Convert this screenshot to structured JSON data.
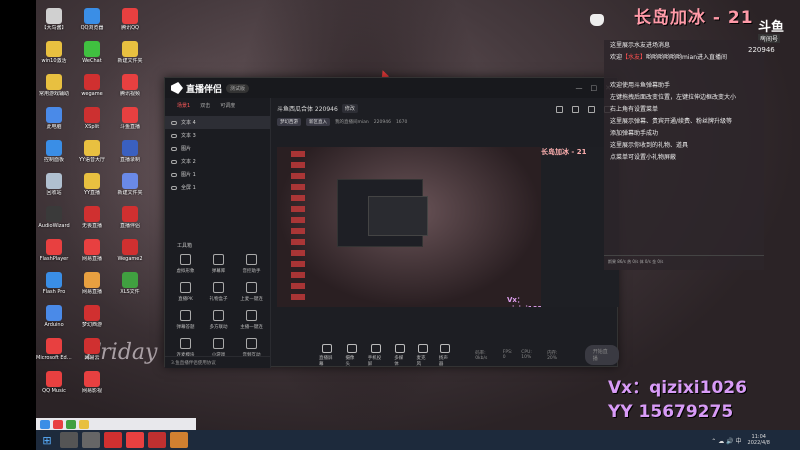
{
  "overlay": {
    "streamer_title": "长岛加冰 - 21",
    "platform": "斗鱼",
    "room_label": "房间号",
    "room_number": "220946",
    "wechat": "Vx：qizixi1026",
    "yy": "YY 15679275"
  },
  "chat": {
    "lines": [
      {
        "text": "这里展示水友进场消息"
      },
      {
        "prefix": "欢迎",
        "red": "【水友】",
        "text": "哟哟哟哟哟哟mian进入直播间"
      },
      {
        "text": ""
      },
      {
        "text": ""
      },
      {
        "text": "欢迎使用斗鱼弹幕助手"
      },
      {
        "text": "左键拖拽后面改变位置，左键拉伸边框改变大小"
      },
      {
        "text": "右上角有设置菜单"
      },
      {
        "text": "这里展示弹幕、贵宾开通/续费、粉丝牌升级等"
      },
      {
        "text": "添加弹幕助手成功"
      },
      {
        "text": "这里展示你收到的礼物、道具"
      },
      {
        "text": "点菜单可设置小礼物屏蔽"
      }
    ],
    "status": "斯果 86/s 热 0/s 体 0/s 金 0/s"
  },
  "desktop_icons": [
    {
      "label": "【大鸟酱】",
      "color": "#d0d0d0"
    },
    {
      "label": "QQ浏览器",
      "color": "#3a8ee6"
    },
    {
      "label": "腾讯QQ",
      "color": "#e84040"
    },
    {
      "label": "win10激活",
      "color": "#e8c040"
    },
    {
      "label": "WeChat",
      "color": "#40c040"
    },
    {
      "label": "新建文件夹",
      "color": "#e8c040"
    },
    {
      "label": "常用游戏辅助",
      "color": "#e8c040"
    },
    {
      "label": "wegame",
      "color": "#d03030"
    },
    {
      "label": "腾讯视频",
      "color": "#e84040"
    },
    {
      "label": "此电脑",
      "color": "#4a8ae8"
    },
    {
      "label": "XSplit",
      "color": "#cc3030"
    },
    {
      "label": "斗鱼直播",
      "color": "#e84040"
    },
    {
      "label": "控制面板",
      "color": "#3a8ee6"
    },
    {
      "label": "YY语音大厅",
      "color": "#e8c040"
    },
    {
      "label": "直播录制",
      "color": "#3a60c0"
    },
    {
      "label": "回收站",
      "color": "#b0c0d0"
    },
    {
      "label": "YY直播",
      "color": "#e8c040"
    },
    {
      "label": "新建文件夹",
      "color": "#6a8ae8"
    },
    {
      "label": "AudioWizard",
      "color": "#3a3a3a"
    },
    {
      "label": "无畏直播",
      "color": "#d03030"
    },
    {
      "label": "直播伴侣",
      "color": "#d03030"
    },
    {
      "label": "FlashPlayer",
      "color": "#e84040"
    },
    {
      "label": "网易直播",
      "color": "#e84040"
    },
    {
      "label": "Wegame2",
      "color": "#d03030"
    },
    {
      "label": "Flash Pro",
      "color": "#3a8ee6"
    },
    {
      "label": "网易直播",
      "color": "#e8a040"
    },
    {
      "label": "XLS文件",
      "color": "#40a040"
    },
    {
      "label": "Arduino",
      "color": "#4a8ae8"
    },
    {
      "label": "梦幻西游",
      "color": "#d03030"
    },
    {
      "label": "",
      "color": "transparent"
    },
    {
      "label": "Microsoft Edge",
      "color": "#e84040"
    },
    {
      "label": "网易云",
      "color": "#d03030"
    },
    {
      "label": "",
      "color": "transparent"
    },
    {
      "label": "QQ Music",
      "color": "#e84040"
    },
    {
      "label": "网易影视",
      "color": "#e84040"
    },
    {
      "label": "",
      "color": "transparent"
    }
  ],
  "app": {
    "name": "直播伴侣",
    "version": "测试版",
    "tabs": [
      "场景1",
      "双击",
      "可调度"
    ],
    "scenes": [
      "文本 4",
      "文本 3",
      "图片",
      "文本 2",
      "图片 1",
      "全屏 1"
    ],
    "tools_title": "工具箱",
    "tools": [
      "虚拟形象",
      "弹幕库",
      "音控助手",
      "直播PK",
      "礼物盒子",
      "上麦一键连",
      "弹幕答题",
      "多方联动",
      "主播一键连",
      "连麦模块",
      "小游戏",
      "音频互动"
    ],
    "footer": "3.鱼直播伴侣使用协议",
    "content_title": "斗鱼西瓜合体 220946",
    "modify": "修改",
    "sub_tags": [
      "梦幻西游",
      "新区直入"
    ],
    "sub_info": "我的直播间mian",
    "sub_count": "220946",
    "sub_likes": "1670",
    "controls": [
      "直播屏幕",
      "摄像头",
      "手机投屏",
      "多媒体",
      "麦克风",
      "扬声器"
    ],
    "stats": [
      "码率: 0kb/s",
      "FPS: 0",
      "CPU: 10%",
      "内存: 20%"
    ],
    "start_button": "开始直播"
  },
  "clock": {
    "time": "11:04",
    "date": "2022/4/8"
  }
}
